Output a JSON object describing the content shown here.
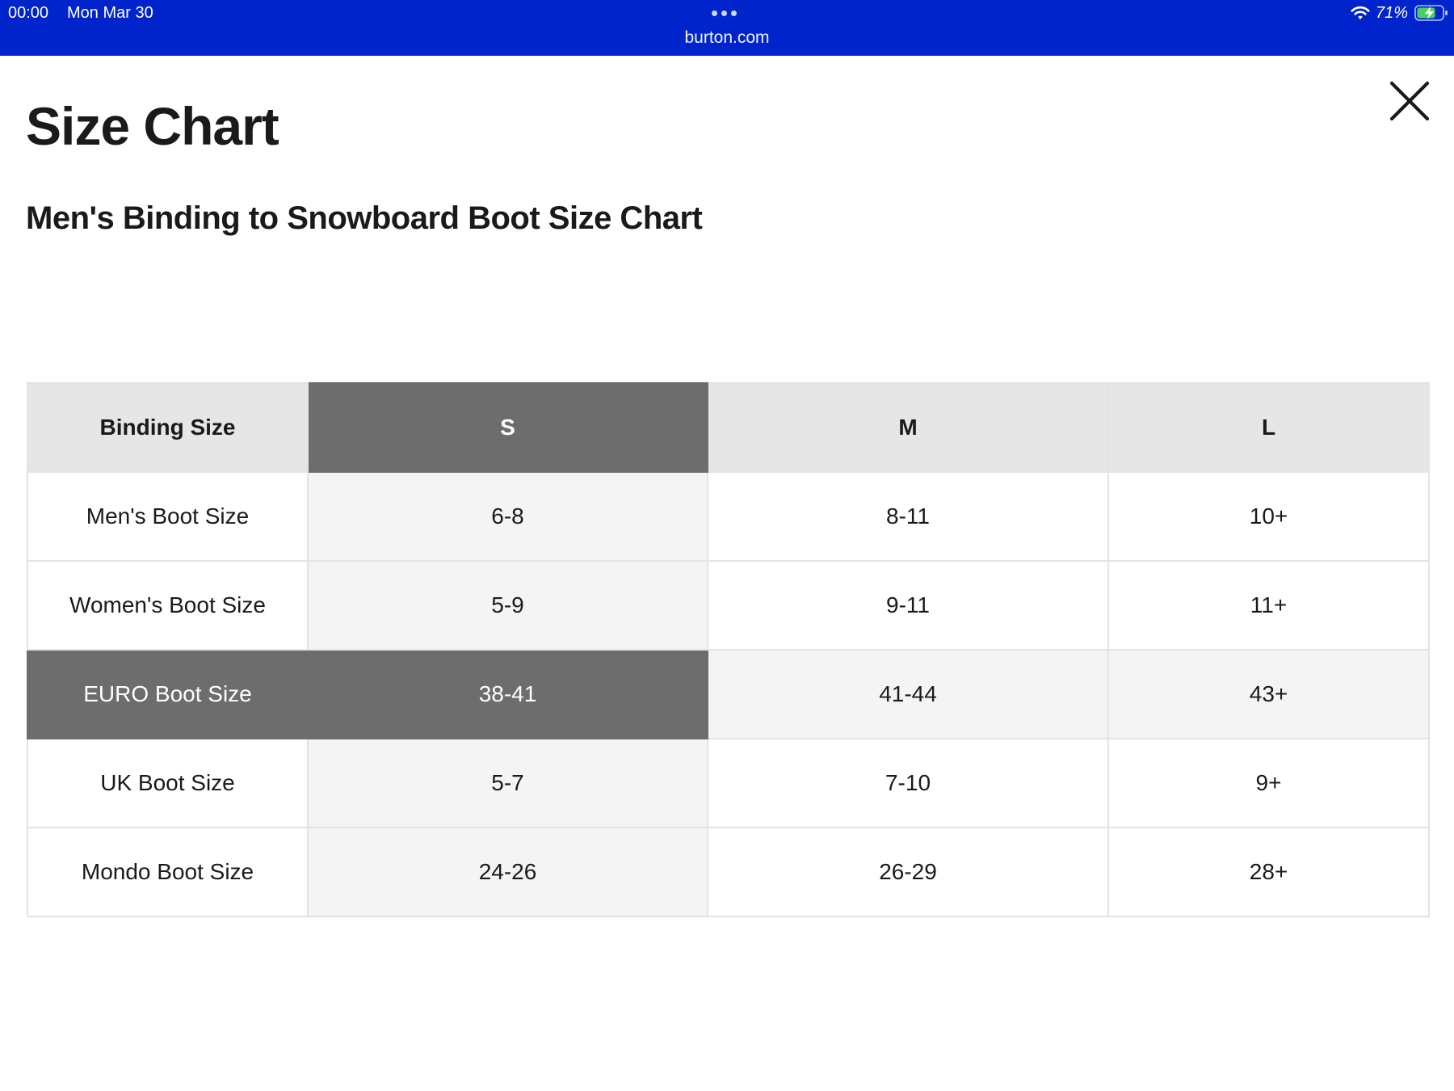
{
  "status_bar": {
    "time": "00:00",
    "date": "Mon Mar 30",
    "url": "burton.com",
    "battery": "71%",
    "icons": [
      "more-dots-icon",
      "wifi-icon",
      "battery-charging-icon"
    ]
  },
  "modal": {
    "title": "Size Chart",
    "subtitle": "Men's Binding to Snowboard Boot Size Chart",
    "close_icon": "close-icon"
  },
  "table": {
    "headers": [
      "Binding Size",
      "S",
      "M",
      "L"
    ],
    "selected_column": "S",
    "selected_row": "EURO Boot Size",
    "rows": [
      {
        "label": "Men's Boot Size",
        "values": [
          "6-8",
          "8-11",
          "10+"
        ]
      },
      {
        "label": "Women's Boot Size",
        "values": [
          "5-9",
          "9-11",
          "11+"
        ]
      },
      {
        "label": "EURO Boot Size",
        "values": [
          "38-41",
          "41-44",
          "43+"
        ]
      },
      {
        "label": "UK Boot Size",
        "values": [
          "5-7",
          "7-10",
          "9+"
        ]
      },
      {
        "label": "Mondo Boot Size",
        "values": [
          "24-26",
          "26-29",
          "28+"
        ]
      }
    ]
  },
  "colors": {
    "status_bar_bg": "#0024cc",
    "highlight": "#6d6d6d",
    "header_bg": "#e6e6e6",
    "alt_cell_bg": "#f4f4f4"
  }
}
